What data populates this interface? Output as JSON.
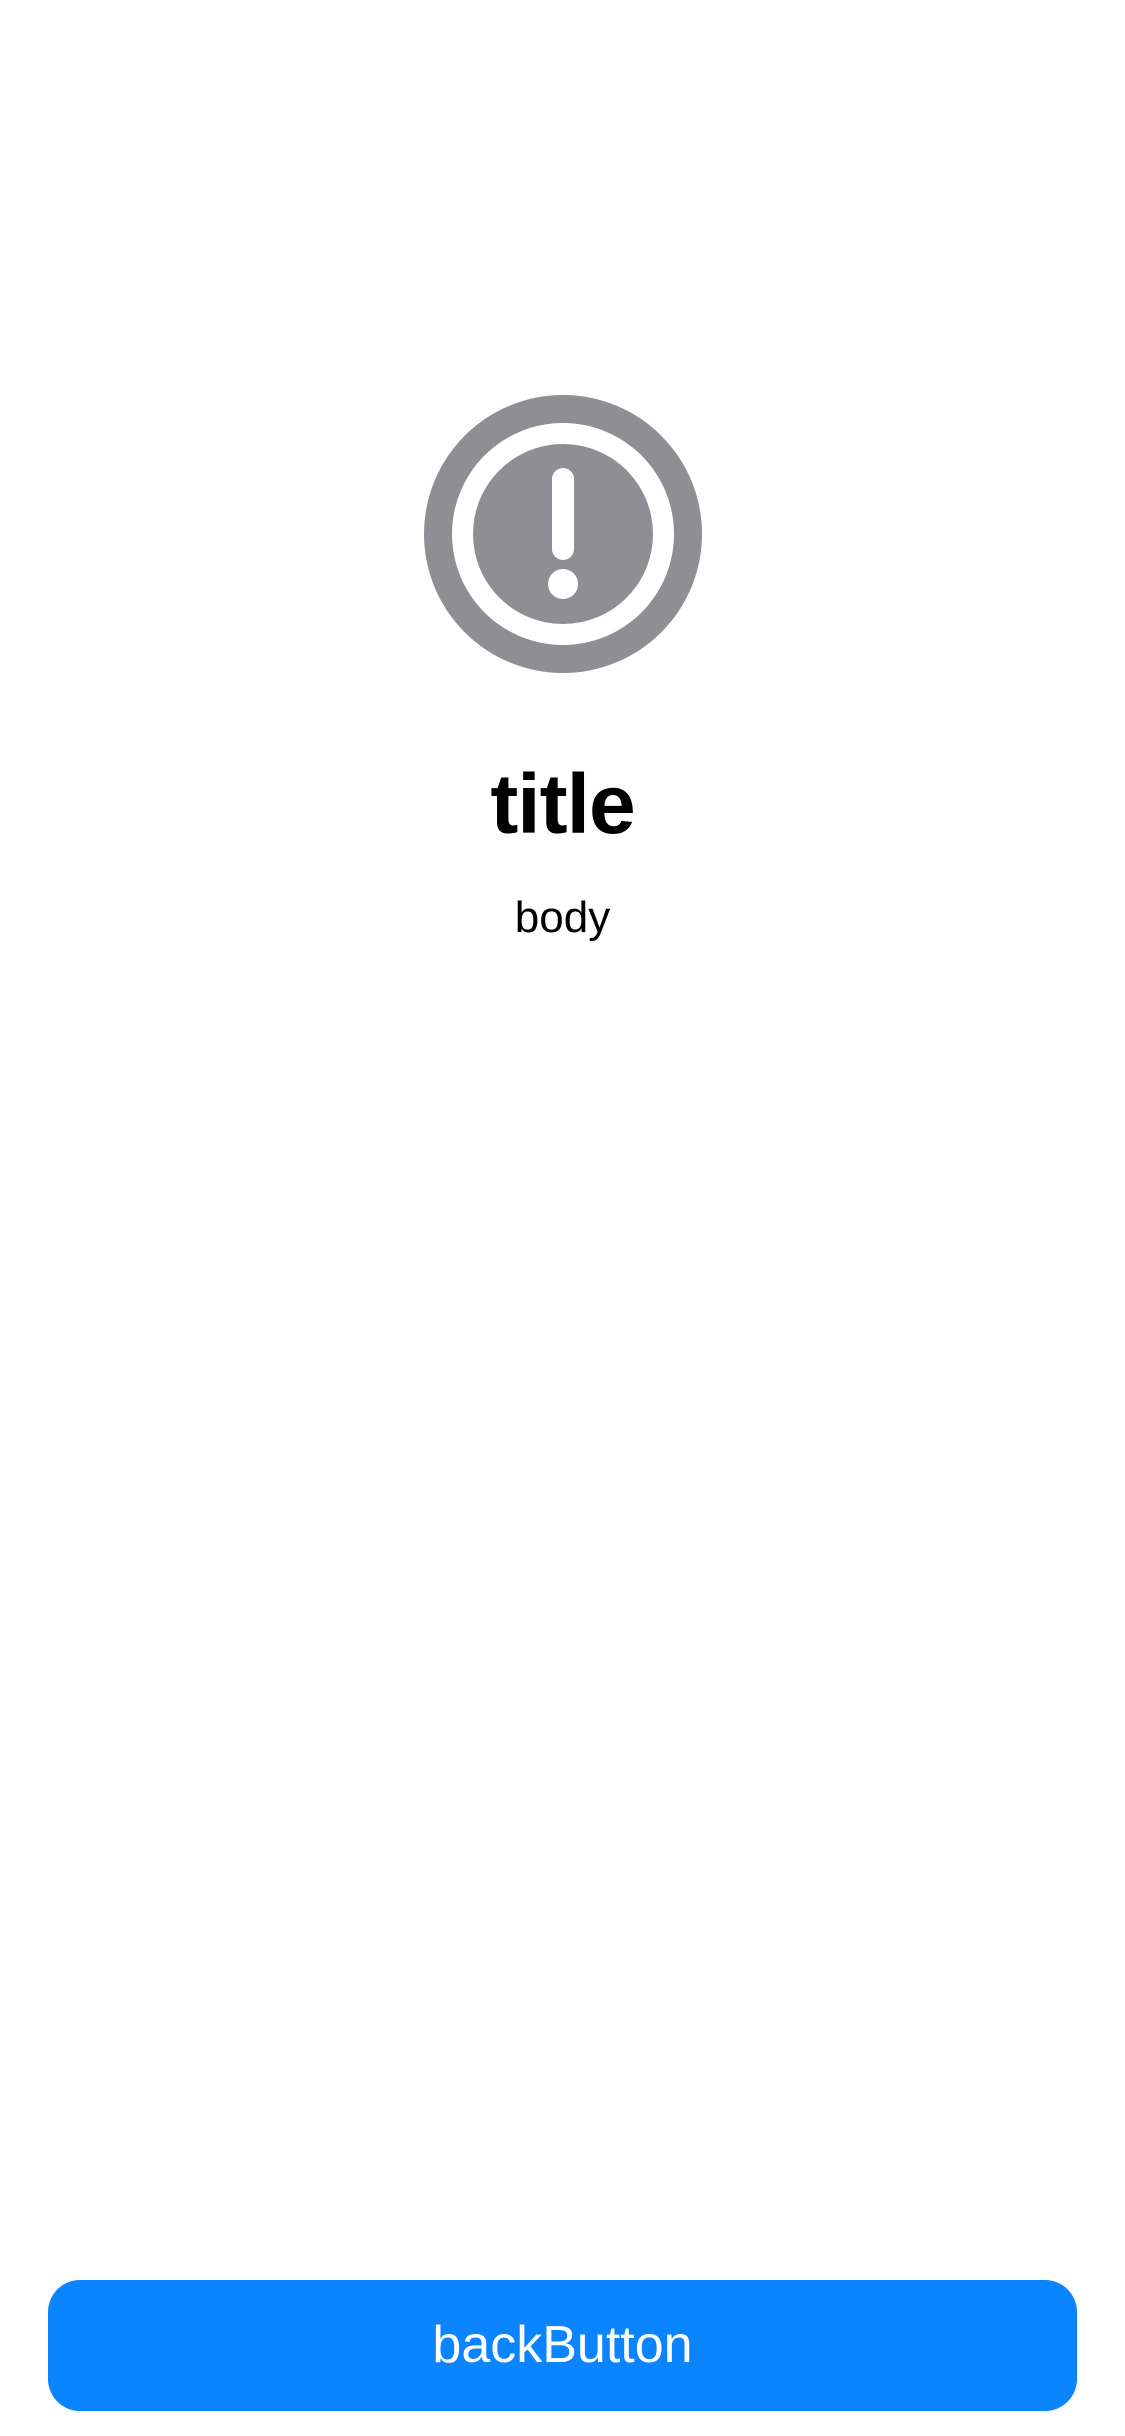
{
  "icon": {
    "name": "exclamation-circle-icon",
    "color": "#8e8e93",
    "foreground": "#ffffff"
  },
  "content": {
    "title": "title",
    "body": "body"
  },
  "actions": {
    "back_button_label": "backButton",
    "back_button_color": "#0a84ff"
  }
}
